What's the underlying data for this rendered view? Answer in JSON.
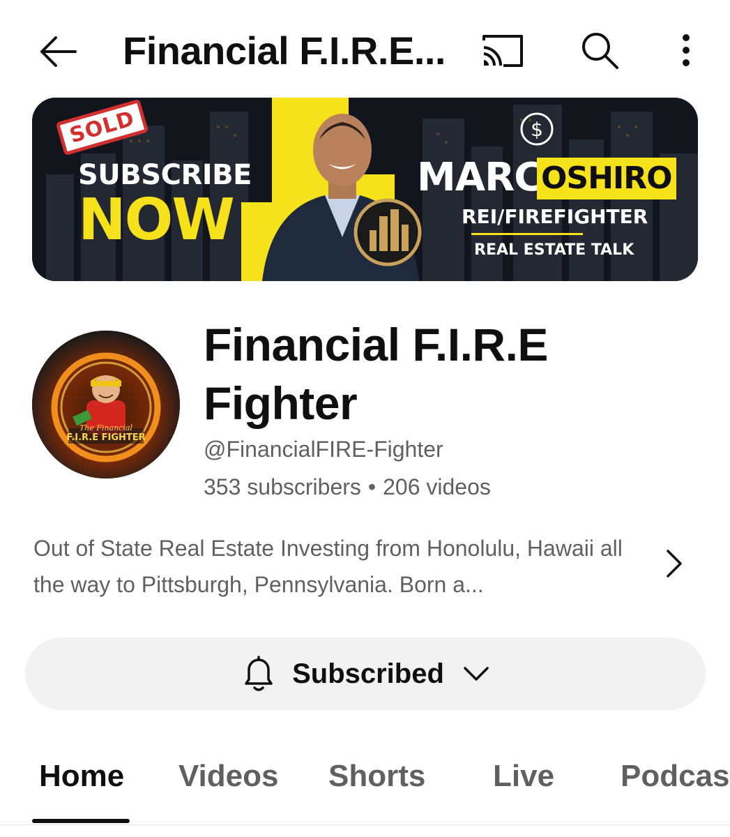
{
  "header": {
    "title": "Financial F.I.R.E..."
  },
  "banner": {
    "badge": "SOLD",
    "cta_line1": "SUBSCRIBE",
    "cta_line2": "NOW",
    "first_name": "MARC",
    "last_name": "OSHIRO",
    "role": "REI/FIREFIGHTER",
    "tagline": "REAL ESTATE TALK",
    "accent_color": "#f6e21b"
  },
  "channel": {
    "name": "Financial F.I.R.E Fighter",
    "handle": "@FinancialFIRE-Fighter",
    "subscribers": "353 subscribers",
    "separator": "•",
    "videos": "206 videos",
    "avatar_text_top": "The Financial",
    "avatar_text_bottom": "F.I.R.E FIGHTER",
    "description": "Out of State Real Estate Investing from Honolulu, Hawaii all the way to Pittsburgh, Pennsylvania.  Born a..."
  },
  "subscribe": {
    "label": "Subscribed",
    "icon": "bell-icon",
    "background": "#f2f2f2"
  },
  "tabs": [
    {
      "label": "Home",
      "active": true
    },
    {
      "label": "Videos",
      "active": false
    },
    {
      "label": "Shorts",
      "active": false
    },
    {
      "label": "Live",
      "active": false
    },
    {
      "label": "Podcasts",
      "active": false
    }
  ],
  "colors": {
    "text_primary": "#0f0f0f",
    "text_secondary": "#606060"
  }
}
